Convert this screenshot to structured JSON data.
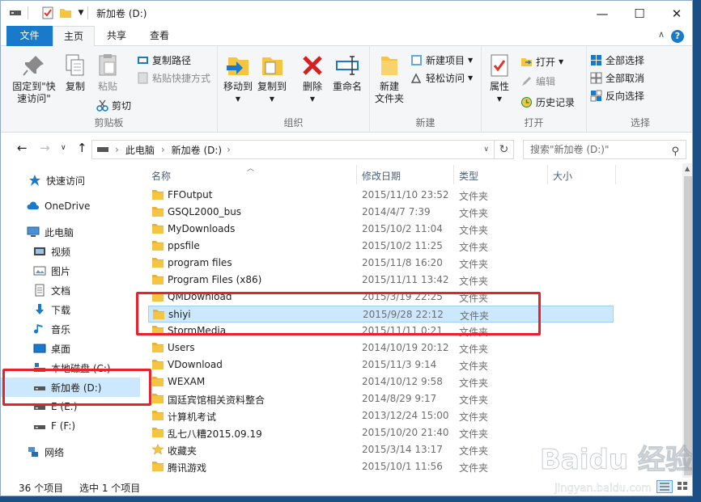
{
  "window": {
    "title": "新加卷 (D:)",
    "minimize": "—",
    "maximize": "☐",
    "close": "✕"
  },
  "tabs": {
    "file": "文件",
    "home": "主页",
    "share": "共享",
    "view": "查看",
    "help": "?"
  },
  "ribbon": {
    "clipboard": {
      "label": "剪贴板",
      "pin": "固定到\"快\n速访问\"",
      "copy": "复制",
      "paste": "粘贴",
      "copy_path": "复制路径",
      "paste_shortcut": "粘贴快捷方式",
      "cut": "剪切"
    },
    "organize": {
      "label": "组织",
      "move_to": "移动到",
      "copy_to": "复制到",
      "delete": "删除",
      "rename": "重命名"
    },
    "new": {
      "label": "新建",
      "new_folder": "新建\n文件夹",
      "new_item": "新建项目",
      "easy_access": "轻松访问"
    },
    "open": {
      "label": "打开",
      "properties": "属性",
      "open": "打开",
      "edit": "编辑",
      "history": "历史记录"
    },
    "select": {
      "label": "选择",
      "select_all": "全部选择",
      "select_none": "全部取消",
      "invert": "反向选择"
    }
  },
  "address": {
    "root": "此电脑",
    "drive": "新加卷 (D:)",
    "sep": "›"
  },
  "search": {
    "placeholder": "搜索\"新加卷 (D:)\""
  },
  "nav": {
    "quick_access": "快速访问",
    "onedrive": "OneDrive",
    "this_pc": "此电脑",
    "videos": "视频",
    "pictures": "图片",
    "documents": "文档",
    "downloads": "下载",
    "music": "音乐",
    "desktop": "桌面",
    "drive_c": "本地磁盘 (C:)",
    "drive_d": "新加卷 (D:)",
    "drive_e": "E (E:)",
    "drive_f": "F (F:)",
    "network": "网络"
  },
  "columns": {
    "name": "名称",
    "date": "修改日期",
    "type": "类型",
    "size": "大小"
  },
  "files": [
    {
      "name": "FFOutput",
      "date": "2015/11/10 23:52",
      "type": "文件夹"
    },
    {
      "name": "GSQL2000_bus",
      "date": "2014/4/7 7:39",
      "type": "文件夹"
    },
    {
      "name": "MyDownloads",
      "date": "2015/10/2 11:04",
      "type": "文件夹"
    },
    {
      "name": "ppsfile",
      "date": "2015/10/2 11:25",
      "type": "文件夹"
    },
    {
      "name": "program files",
      "date": "2015/11/8 16:20",
      "type": "文件夹"
    },
    {
      "name": "Program Files (x86)",
      "date": "2015/11/11 13:42",
      "type": "文件夹"
    },
    {
      "name": "QMDownload",
      "date": "2015/3/19 22:25",
      "type": "文件夹"
    },
    {
      "name": "shiyi",
      "date": "2015/9/28 22:12",
      "type": "文件夹"
    },
    {
      "name": "StormMedia",
      "date": "2015/11/11 0:21",
      "type": "文件夹"
    },
    {
      "name": "Users",
      "date": "2014/10/19 20:12",
      "type": "文件夹"
    },
    {
      "name": "VDownload",
      "date": "2015/11/3 9:14",
      "type": "文件夹"
    },
    {
      "name": "WEXAM",
      "date": "2014/10/12 9:58",
      "type": "文件夹"
    },
    {
      "name": "国廷宾馆相关资料整合",
      "date": "2014/8/29 9:17",
      "type": "文件夹"
    },
    {
      "name": "计算机考试",
      "date": "2013/12/24 15:00",
      "type": "文件夹"
    },
    {
      "name": "乱七八糟2015.09.19",
      "date": "2015/10/20 21:40",
      "type": "文件夹"
    },
    {
      "name": "收藏夹",
      "date": "2015/3/14 13:17",
      "type": "文件夹"
    },
    {
      "name": "腾讯游戏",
      "date": "2015/10/1 11:56",
      "type": "文件夹"
    }
  ],
  "status": {
    "count": "36 个项目",
    "selected": "选中 1 个项目"
  },
  "watermark": {
    "text": "Baidu 经验",
    "url": "jingyan.baidu.com"
  },
  "colors": {
    "accent": "#1979ca",
    "selection": "#cce8ff",
    "highlight": "#e8222a",
    "folder": "#f5c542"
  }
}
